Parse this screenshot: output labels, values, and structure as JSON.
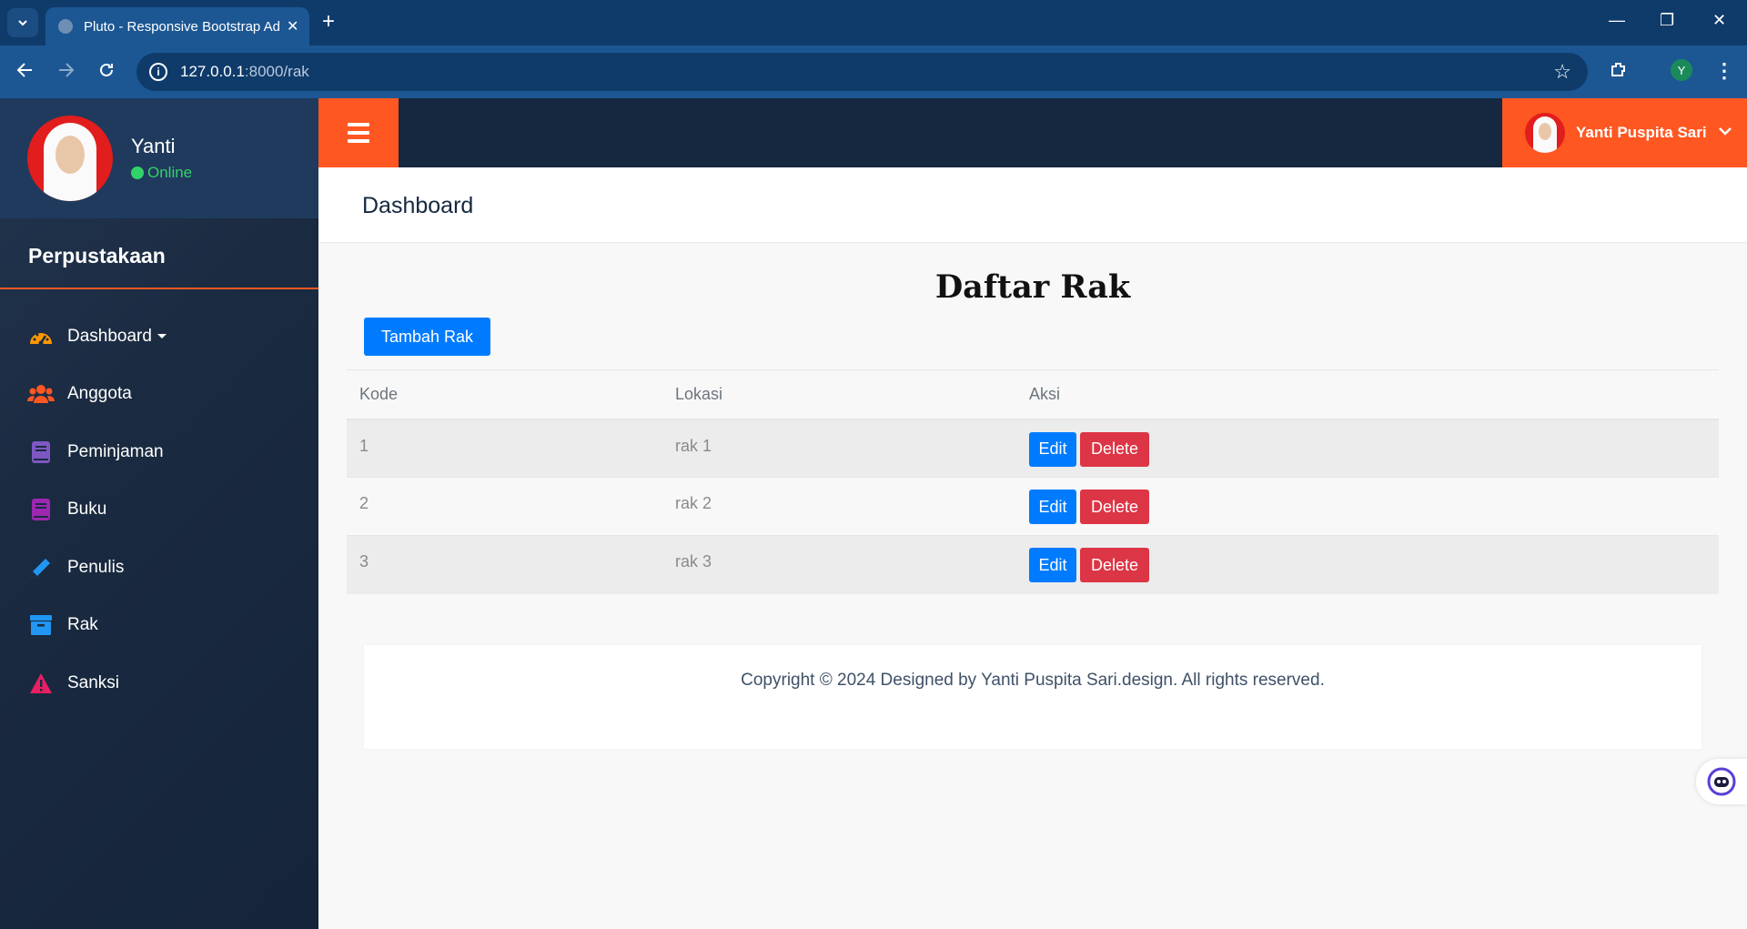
{
  "browser": {
    "tab_title": "Pluto - Responsive Bootstrap Admin",
    "tab_close": "✕",
    "new_tab": "+",
    "url_host": "127.0.0.1",
    "url_path": ":8000/rak",
    "profile_letter": "Y",
    "win_min": "—",
    "win_restore": "❐",
    "win_close": "✕"
  },
  "sidebar": {
    "user_name": "Yanti",
    "user_status": "Online",
    "brand": "Perpustakaan",
    "items": [
      {
        "label": "Dashboard",
        "icon": "dashboard-icon",
        "color": "#ff9800"
      },
      {
        "label": "Anggota",
        "icon": "users-icon",
        "color": "#ff5722"
      },
      {
        "label": "Peminjaman",
        "icon": "book-icon",
        "color": "#7e57c2"
      },
      {
        "label": "Buku",
        "icon": "book-icon",
        "color": "#9c27b0"
      },
      {
        "label": "Penulis",
        "icon": "pencil-icon",
        "color": "#2196f3"
      },
      {
        "label": "Rak",
        "icon": "archive-icon",
        "color": "#2196f3"
      },
      {
        "label": "Sanksi",
        "icon": "warning-icon",
        "color": "#e91e63"
      }
    ]
  },
  "topbar": {
    "user_full_name": "Yanti Puspita Sari"
  },
  "page": {
    "heading": "Dashboard",
    "title": "Daftar Rak",
    "add_button": "Tambah Rak"
  },
  "table": {
    "headers": [
      "Kode",
      "Lokasi",
      "Aksi"
    ],
    "rows": [
      {
        "kode": "1",
        "lokasi": "rak 1"
      },
      {
        "kode": "2",
        "lokasi": "rak 2"
      },
      {
        "kode": "3",
        "lokasi": "rak 3"
      }
    ],
    "edit_label": "Edit",
    "delete_label": "Delete"
  },
  "footer": {
    "text": "Copyright © 2024 Designed by Yanti Puspita Sari.design. All rights reserved."
  },
  "colors": {
    "accent": "#ff5722",
    "primary": "#007bff",
    "danger": "#dc3545",
    "sidebar": "#1b2a41"
  }
}
